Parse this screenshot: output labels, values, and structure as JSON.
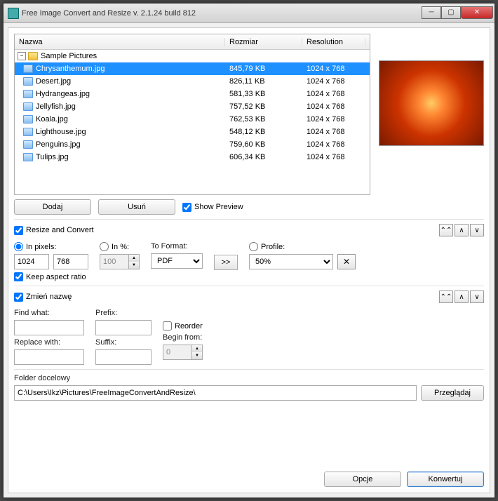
{
  "window": {
    "title": "Free Image Convert and Resize  v. 2.1.24 build 812"
  },
  "list": {
    "headers": {
      "name": "Nazwa",
      "size": "Rozmiar",
      "resolution": "Resolution"
    },
    "folder": "Sample Pictures",
    "rows": [
      {
        "name": "Chrysanthemum.jpg",
        "size": "845,79 KB",
        "res": "1024 x 768",
        "selected": true
      },
      {
        "name": "Desert.jpg",
        "size": "826,11 KB",
        "res": "1024 x 768"
      },
      {
        "name": "Hydrangeas.jpg",
        "size": "581,33 KB",
        "res": "1024 x 768"
      },
      {
        "name": "Jellyfish.jpg",
        "size": "757,52 KB",
        "res": "1024 x 768"
      },
      {
        "name": "Koala.jpg",
        "size": "762,53 KB",
        "res": "1024 x 768"
      },
      {
        "name": "Lighthouse.jpg",
        "size": "548,12 KB",
        "res": "1024 x 768"
      },
      {
        "name": "Penguins.jpg",
        "size": "759,60 KB",
        "res": "1024 x 768"
      },
      {
        "name": "Tulips.jpg",
        "size": "606,34 KB",
        "res": "1024 x 768"
      }
    ]
  },
  "buttons": {
    "add": "Dodaj",
    "remove": "Usuń",
    "show_preview": "Show Preview",
    "browse": "Przeglądaj",
    "options": "Opcje",
    "convert": "Konwertuj"
  },
  "resize": {
    "title": "Resize and Convert",
    "in_pixels": "In pixels:",
    "in_percent": "In %:",
    "width": "1024",
    "height": "768",
    "percent": "100",
    "keep_aspect": "Keep aspect ratio",
    "to_format": "To Format:",
    "format_value": "PDF",
    "profile": "Profile:",
    "profile_value": "50%"
  },
  "rename": {
    "title": "Zmień nazwę",
    "find_what": "Find what:",
    "replace_with": "Replace with:",
    "prefix": "Prefix:",
    "suffix": "Suffix:",
    "reorder": "Reorder",
    "begin_from": "Begin from:",
    "begin_value": "0"
  },
  "folder": {
    "label": "Folder docelowy",
    "path": "C:\\Users\\Ikz\\Pictures\\FreeImageConvertAndResize\\"
  }
}
